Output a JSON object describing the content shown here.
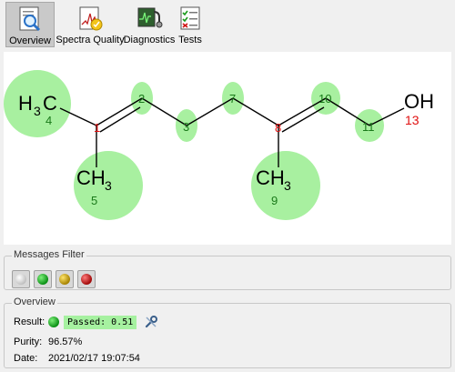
{
  "toolbar": {
    "overview_label": "Overview",
    "spectra_quality_label": "Spectra Quality",
    "diagnostics_label": "Diagnostics",
    "tests_label": "Tests"
  },
  "molecule": {
    "atoms": {
      "c4_label": "C",
      "c4_num": "4",
      "c5_label": "CH",
      "c5_sub": "3",
      "c5_num": "5",
      "c9_label": "CH",
      "c9_sub": "3",
      "c9_num": "9",
      "oh_label": "OH",
      "oh_num": "13",
      "n1": "1",
      "n2": "2",
      "n3": "3",
      "n7": "7",
      "n8": "8",
      "n10": "10",
      "n11": "11",
      "h3_label": "H",
      "h3_sub": "3"
    },
    "colors": {
      "highlight": "#a8f0a0",
      "bond": "#000000",
      "number": "#1a7a1a",
      "stereo_number": "#e01010"
    }
  },
  "messages_filter": {
    "title": "Messages Filter",
    "buttons": [
      {
        "name": "white",
        "color": "#f4f4f4"
      },
      {
        "name": "green",
        "color": "#1ea01e"
      },
      {
        "name": "yellow",
        "color": "#c8a800"
      },
      {
        "name": "red",
        "color": "#c01010"
      }
    ]
  },
  "overview": {
    "title": "Overview",
    "result_label": "Result:",
    "result_value": "Passed: 0.51",
    "purity_label": "Purity:",
    "purity_value": "96.57%",
    "date_label": "Date:",
    "date_value": "2021/02/17 19:07:54"
  }
}
